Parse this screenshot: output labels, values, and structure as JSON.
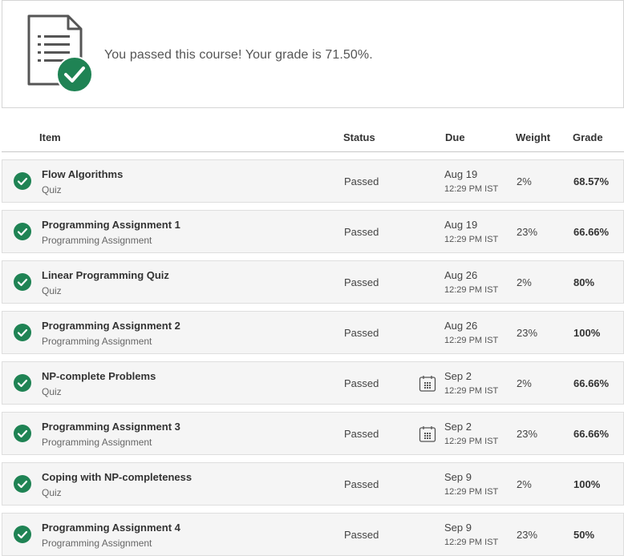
{
  "banner": {
    "message": "You passed this course! Your grade is 71.50%.",
    "icon": "document-check-icon"
  },
  "table": {
    "headers": {
      "item": "Item",
      "status": "Status",
      "due": "Due",
      "weight": "Weight",
      "grade": "Grade"
    },
    "rows": [
      {
        "title": "Flow Algorithms",
        "type": "Quiz",
        "status": "Passed",
        "due_date": "Aug 19",
        "due_time": "12:29 PM IST",
        "calendar_icon": false,
        "weight": "2%",
        "grade": "68.57%"
      },
      {
        "title": "Programming Assignment 1",
        "type": "Programming Assignment",
        "status": "Passed",
        "due_date": "Aug 19",
        "due_time": "12:29 PM IST",
        "calendar_icon": false,
        "weight": "23%",
        "grade": "66.66%"
      },
      {
        "title": "Linear Programming Quiz",
        "type": "Quiz",
        "status": "Passed",
        "due_date": "Aug 26",
        "due_time": "12:29 PM IST",
        "calendar_icon": false,
        "weight": "2%",
        "grade": "80%"
      },
      {
        "title": "Programming Assignment 2",
        "type": "Programming Assignment",
        "status": "Passed",
        "due_date": "Aug 26",
        "due_time": "12:29 PM IST",
        "calendar_icon": false,
        "weight": "23%",
        "grade": "100%"
      },
      {
        "title": "NP-complete Problems",
        "type": "Quiz",
        "status": "Passed",
        "due_date": "Sep 2",
        "due_time": "12:29 PM IST",
        "calendar_icon": true,
        "weight": "2%",
        "grade": "66.66%"
      },
      {
        "title": "Programming Assignment 3",
        "type": "Programming Assignment",
        "status": "Passed",
        "due_date": "Sep 2",
        "due_time": "12:29 PM IST",
        "calendar_icon": true,
        "weight": "23%",
        "grade": "66.66%"
      },
      {
        "title": "Coping with NP-completeness",
        "type": "Quiz",
        "status": "Passed",
        "due_date": "Sep 9",
        "due_time": "12:29 PM IST",
        "calendar_icon": false,
        "weight": "2%",
        "grade": "100%"
      },
      {
        "title": "Programming Assignment 4",
        "type": "Programming Assignment",
        "status": "Passed",
        "due_date": "Sep 9",
        "due_time": "12:29 PM IST",
        "calendar_icon": false,
        "weight": "23%",
        "grade": "50%"
      }
    ]
  },
  "colors": {
    "success": "#1f8354",
    "row_bg": "#f5f5f5",
    "border": "#dedede"
  }
}
